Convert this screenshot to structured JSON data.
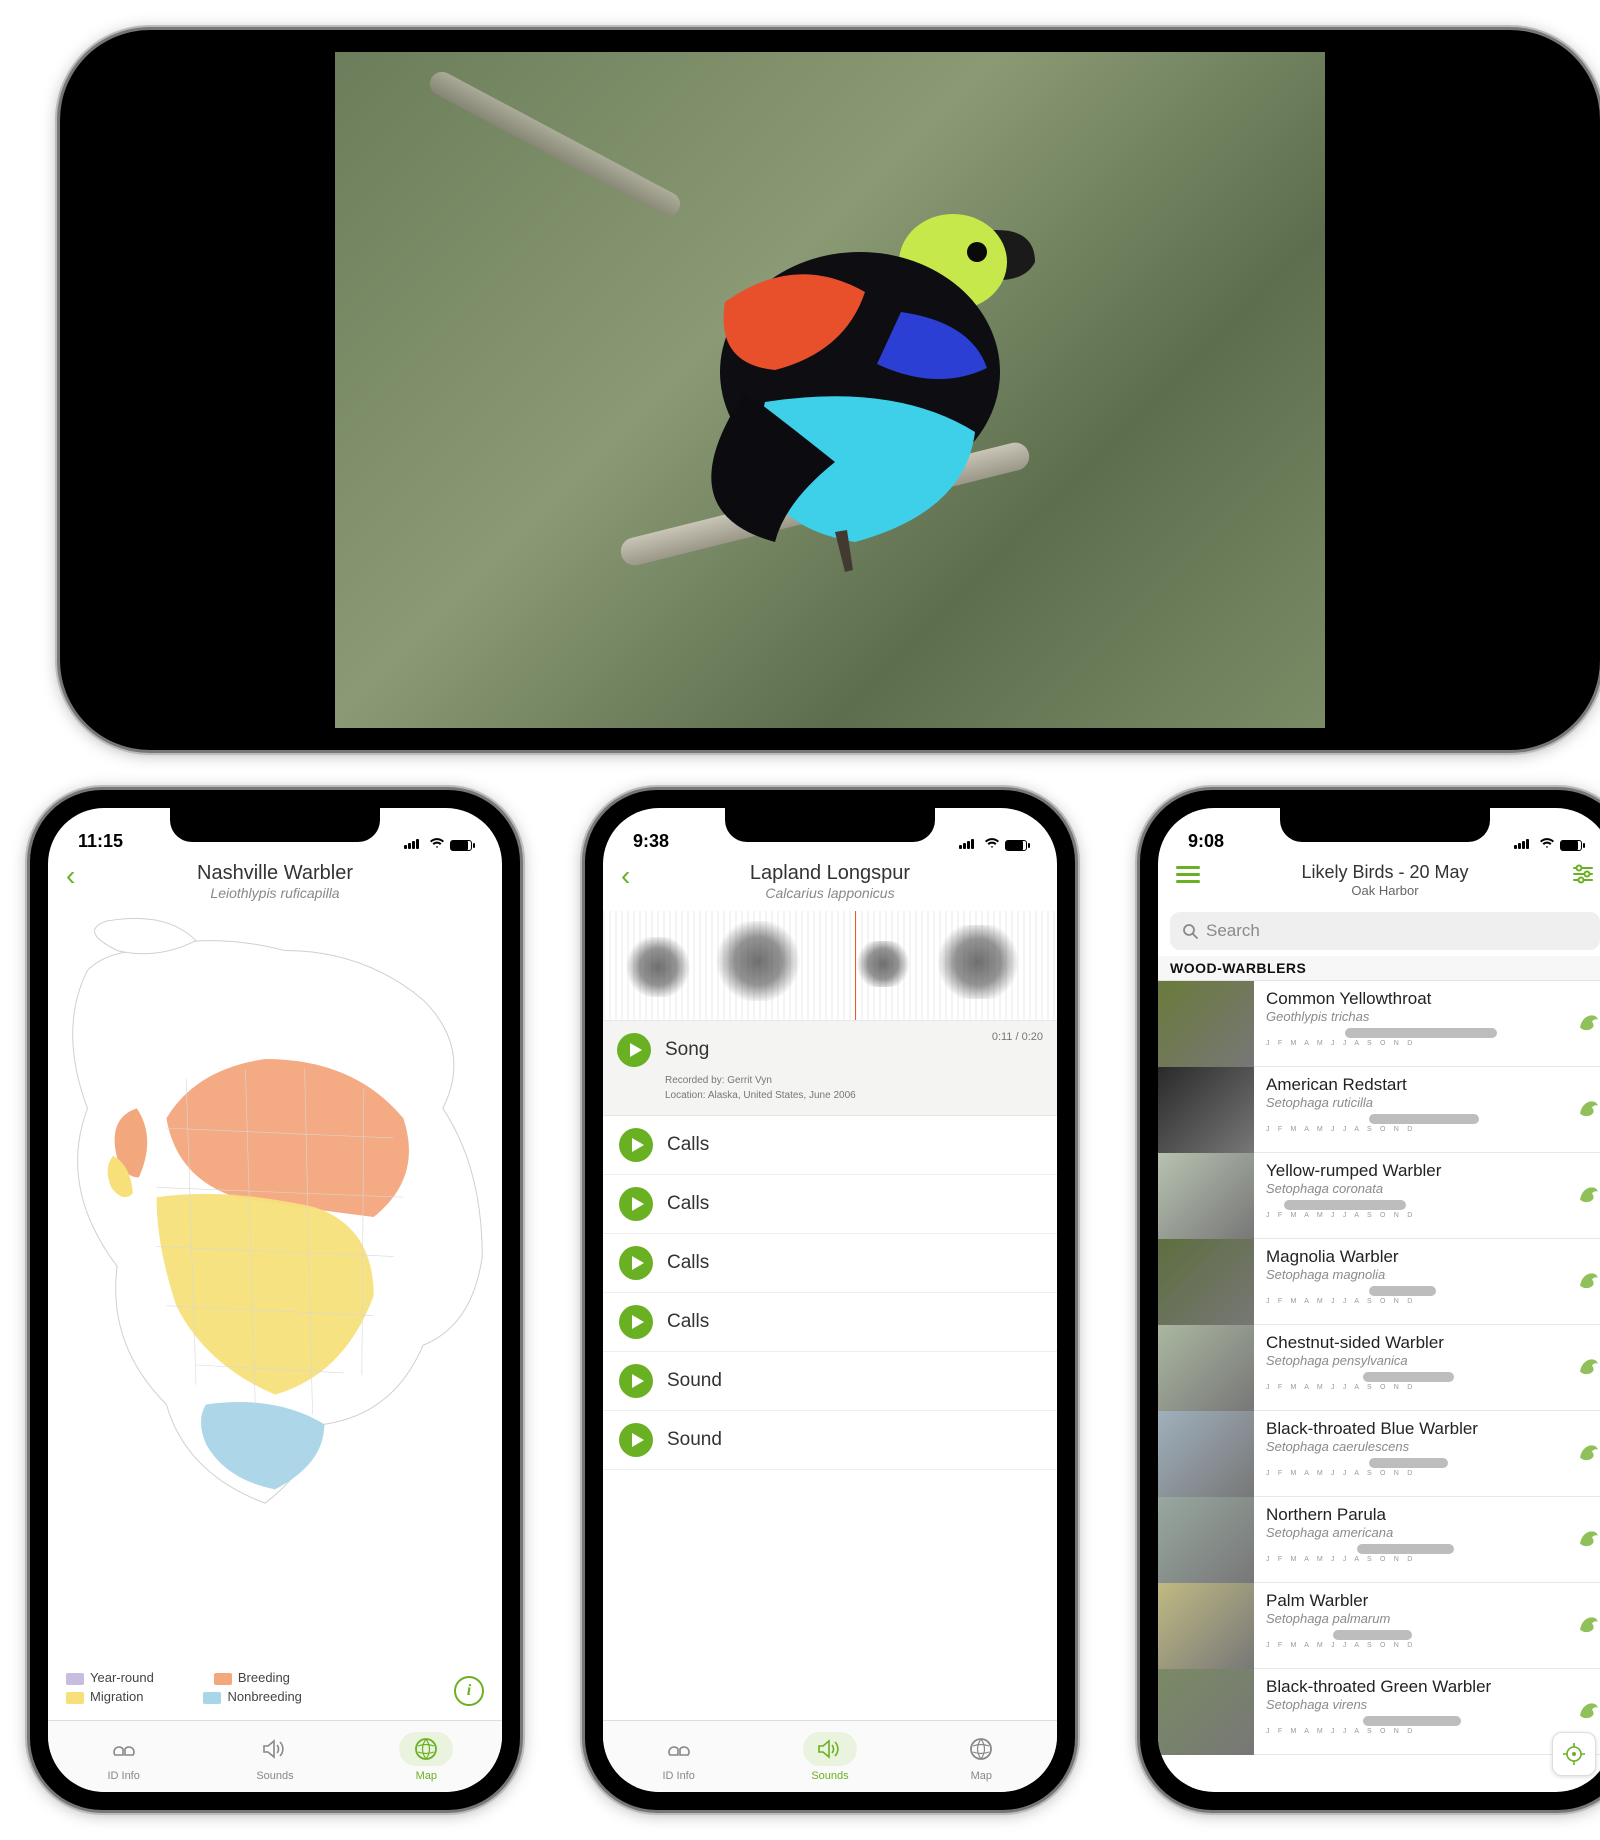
{
  "colors": {
    "accent": "#6ab023",
    "breeding": "#f3a77d",
    "migration": "#f7e07a",
    "yearround": "#c7bde0",
    "nonbreeding": "#a9d5e8"
  },
  "hero": {
    "alt": "Paradise Tanager perched on a branch"
  },
  "map_screen": {
    "status_time": "11:15",
    "title": "Nashville Warbler",
    "subtitle": "Leiothlypis ruficapilla",
    "legend": {
      "yearround": "Year-round",
      "breeding": "Breeding",
      "migration": "Migration",
      "nonbreeding": "Nonbreeding"
    },
    "tabs": {
      "id": "ID Info",
      "sounds": "Sounds",
      "map": "Map"
    },
    "active_tab": "map"
  },
  "sounds_screen": {
    "status_time": "9:38",
    "title": "Lapland Longspur",
    "subtitle": "Calcarius lapponicus",
    "timecode": "0:11 / 0:20",
    "now_playing": {
      "label": "Song",
      "recorded_by_label": "Recorded by:",
      "recorded_by": "Gerrit Vyn",
      "location_label": "Location:",
      "location": "Alaska, United States, June 2006"
    },
    "rows": [
      "Calls",
      "Calls",
      "Calls",
      "Calls",
      "Sound",
      "Sound"
    ],
    "tabs": {
      "id": "ID Info",
      "sounds": "Sounds",
      "map": "Map"
    },
    "active_tab": "sounds"
  },
  "list_screen": {
    "status_time": "9:08",
    "title": "Likely Birds - 20 May",
    "subtitle": "Oak Harbor",
    "search_placeholder": "Search",
    "section": "WOOD-WARBLERS",
    "months_axis": "J F M A M J J A S O N D",
    "birds": [
      {
        "name": "Common Yellowthroat",
        "sci": "Geothlypis trichas",
        "thumb_bg": "#6a7a3a",
        "bar_start": 26,
        "bar_end": 76
      },
      {
        "name": "American Redstart",
        "sci": "Setophaga ruticilla",
        "thumb_bg": "#2a2a2a",
        "bar_start": 34,
        "bar_end": 70
      },
      {
        "name": "Yellow-rumped Warbler",
        "sci": "Setophaga coronata",
        "thumb_bg": "#b7c2b0",
        "bar_start": 6,
        "bar_end": 46
      },
      {
        "name": "Magnolia Warbler",
        "sci": "Setophaga magnolia",
        "thumb_bg": "#5e6e3e",
        "bar_start": 34,
        "bar_end": 56
      },
      {
        "name": "Chestnut-sided Warbler",
        "sci": "Setophaga pensylvanica",
        "thumb_bg": "#aab7a0",
        "bar_start": 32,
        "bar_end": 62
      },
      {
        "name": "Black-throated Blue Warbler",
        "sci": "Setophaga caerulescens",
        "thumb_bg": "#9fb0bc",
        "bar_start": 34,
        "bar_end": 60
      },
      {
        "name": "Northern Parula",
        "sci": "Setophaga americana",
        "thumb_bg": "#98a8a0",
        "bar_start": 30,
        "bar_end": 62
      },
      {
        "name": "Palm Warbler",
        "sci": "Setophaga palmarum",
        "thumb_bg": "#c0ba83",
        "bar_start": 22,
        "bar_end": 48
      },
      {
        "name": "Black-throated Green Warbler",
        "sci": "Setophaga virens",
        "thumb_bg": "#7a8a64",
        "bar_start": 32,
        "bar_end": 64
      }
    ]
  }
}
